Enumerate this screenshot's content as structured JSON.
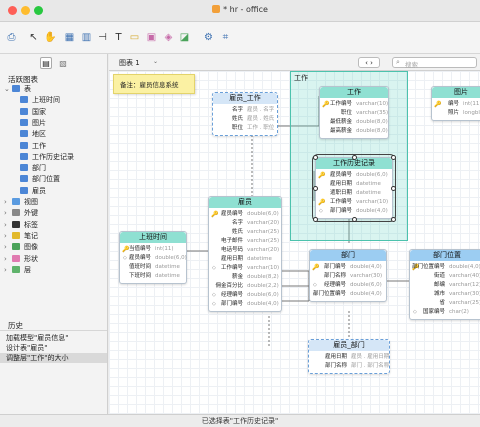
{
  "window": {
    "title": "* hr - office",
    "status": "已选择表\"工作历史记录\""
  },
  "sidebar": {
    "section_title": "活跃图表",
    "tree": [
      {
        "label": "表",
        "kind": "group",
        "color": "#4c86d6"
      },
      {
        "label": "上班时间",
        "kind": "table",
        "color": "#4c86d6"
      },
      {
        "label": "国家",
        "kind": "table",
        "color": "#4c86d6"
      },
      {
        "label": "图片",
        "kind": "table",
        "color": "#4c86d6"
      },
      {
        "label": "地区",
        "kind": "table",
        "color": "#4c86d6"
      },
      {
        "label": "工作",
        "kind": "table",
        "color": "#4c86d6"
      },
      {
        "label": "工作历史记录",
        "kind": "table",
        "color": "#4c86d6"
      },
      {
        "label": "部门",
        "kind": "table",
        "color": "#4c86d6"
      },
      {
        "label": "部门位置",
        "kind": "table",
        "color": "#4c86d6"
      },
      {
        "label": "雇员",
        "kind": "table",
        "color": "#4c86d6"
      },
      {
        "label": "视图",
        "kind": "group",
        "color": "#5a9be0"
      },
      {
        "label": "外键",
        "kind": "group",
        "color": "#888888"
      },
      {
        "label": "标签",
        "kind": "group",
        "color": "#333333"
      },
      {
        "label": "笔记",
        "kind": "group",
        "color": "#e2b92c"
      },
      {
        "label": "图像",
        "kind": "group",
        "color": "#4aa35a"
      },
      {
        "label": "形状",
        "kind": "group",
        "color": "#e07ab0"
      },
      {
        "label": "层",
        "kind": "group",
        "color": "#5fb36b"
      }
    ],
    "history_title": "历史",
    "history": [
      "加载模型\"雇员信息\"",
      "设计表\"雇员\"",
      "调整层\"工作\"的大小"
    ]
  },
  "canvas": {
    "tab_label": "图表 1",
    "search_placeholder": "搜索",
    "note": "备注：雇员信息系统",
    "layer_label": "工作",
    "tables": {
      "emp_job": {
        "title": "雇员_工作",
        "rows": [
          {
            "name": "名字",
            "type": "雇员 . 名字"
          },
          {
            "name": "姓氏",
            "type": "雇员 . 姓氏"
          },
          {
            "name": "职位",
            "type": "工作 . 职位"
          }
        ]
      },
      "job": {
        "title": "工作",
        "rows": [
          {
            "name": "工作编号",
            "type": "varchar(10)",
            "pk": true
          },
          {
            "name": "职位",
            "type": "varchar(35)"
          },
          {
            "name": "最低薪金",
            "type": "double(8,0)"
          },
          {
            "name": "最高薪金",
            "type": "double(8,0)"
          }
        ]
      },
      "image": {
        "title": "图片",
        "rows": [
          {
            "name": "编号",
            "type": "int(11)",
            "pk": true
          },
          {
            "name": "照片",
            "type": "longblob"
          }
        ]
      },
      "job_history": {
        "title": "工作历史记录",
        "rows": [
          {
            "name": "雇员编号",
            "type": "double(6,0)",
            "pk": true
          },
          {
            "name": "雇用日期",
            "type": "datetime"
          },
          {
            "name": "遣职日期",
            "type": "datetime"
          },
          {
            "name": "工作编号",
            "type": "varchar(10)",
            "pk": true
          },
          {
            "name": "部门编号",
            "type": "double(4,0)",
            "fk": true
          }
        ]
      },
      "employee": {
        "title": "雇员",
        "rows": [
          {
            "name": "雇员编号",
            "type": "double(6,0)",
            "pk": true
          },
          {
            "name": "名字",
            "type": "varchar(20)"
          },
          {
            "name": "姓氏",
            "type": "varchar(25)"
          },
          {
            "name": "电子邮件",
            "type": "varchar(25)"
          },
          {
            "name": "电话号码",
            "type": "varchar(20)"
          },
          {
            "name": "雇用日期",
            "type": "datetime"
          },
          {
            "name": "工作编号",
            "type": "varchar(10)",
            "fk": true
          },
          {
            "name": "薪金",
            "type": "double(8,2)"
          },
          {
            "name": "佣金百分比",
            "type": "double(2,2)"
          },
          {
            "name": "经理编号",
            "type": "double(6,0)",
            "fk": true
          },
          {
            "name": "部门编号",
            "type": "double(4,0)",
            "fk": true
          }
        ]
      },
      "work_time": {
        "title": "上班时间",
        "rows": [
          {
            "name": "当值编号",
            "type": "int(11)",
            "pk": true
          },
          {
            "name": "雇员编号",
            "type": "double(6,0)",
            "fk": true
          },
          {
            "name": "值班时间",
            "type": "datetime"
          },
          {
            "name": "下班时间",
            "type": "datetime"
          }
        ]
      },
      "dept": {
        "title": "部门",
        "rows": [
          {
            "name": "部门编号",
            "type": "double(4,0)",
            "pk": true
          },
          {
            "name": "部门名称",
            "type": "varchar(30)"
          },
          {
            "name": "经理编号",
            "type": "double(6,0)",
            "fk": true
          },
          {
            "name": "部门位置编号",
            "type": "double(4,0)",
            "fk": true
          }
        ]
      },
      "dept_loc": {
        "title": "部门位置",
        "rows": [
          {
            "name": "部门位置编号",
            "type": "double(4,0)",
            "pk": true
          },
          {
            "name": "街道",
            "type": "varchar(40)"
          },
          {
            "name": "邮编",
            "type": "varchar(12)"
          },
          {
            "name": "城市",
            "type": "varchar(30)"
          },
          {
            "name": "省",
            "type": "varchar(25)"
          },
          {
            "name": "国家编号",
            "type": "char(2)",
            "fk": true
          }
        ]
      },
      "emp_dept": {
        "title": "雇员_部门",
        "rows": [
          {
            "name": "雇用日期",
            "type": "雇员 . 雇用日期"
          },
          {
            "name": "部门名称",
            "type": "部门 . 部门名称"
          }
        ]
      }
    }
  }
}
